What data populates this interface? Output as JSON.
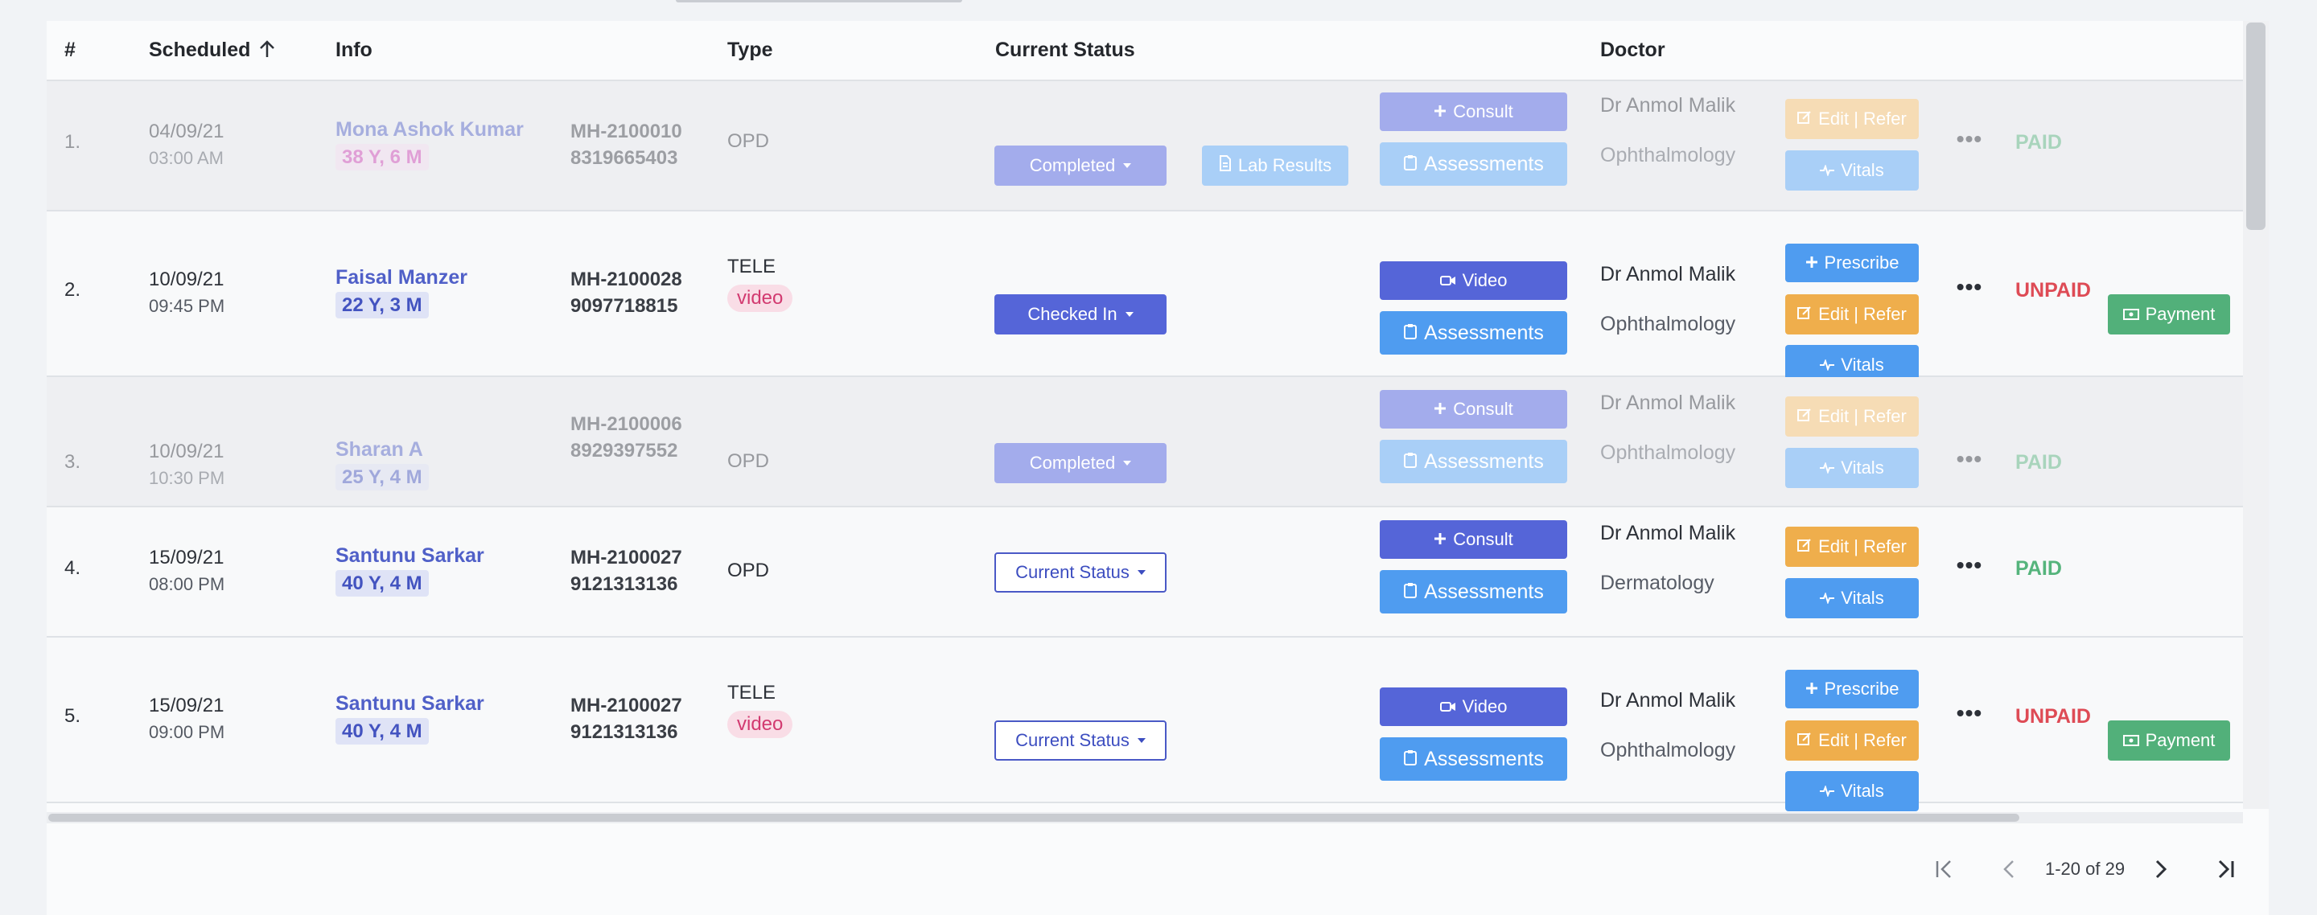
{
  "table": {
    "headers": {
      "num": "#",
      "scheduled": "Scheduled",
      "info": "Info",
      "type": "Type",
      "current_status": "Current Status",
      "doctor": "Doctor"
    },
    "rows": [
      {
        "num": "1.",
        "date": "04/09/21",
        "time": "03:00 AM",
        "name": "Mona Ashok Kumar",
        "age": "38 Y, 6 M",
        "mrn": "MH-2100010",
        "phone": "8319665403",
        "type": "OPD",
        "type_tag": "",
        "status": "Completed",
        "lab": "Lab Results",
        "action": "Consult",
        "assess": "Assessments",
        "doctor": "Dr Anmol Malik",
        "specialty": "Ophthalmology",
        "prescribe": "",
        "edit": "Edit | Refer",
        "vitals": "Vitals",
        "payment_status": "PAID",
        "payment_button": ""
      },
      {
        "num": "2.",
        "date": "10/09/21",
        "time": "09:45 PM",
        "name": "Faisal Manzer",
        "age": "22 Y, 3 M",
        "mrn": "MH-2100028",
        "phone": "9097718815",
        "type": "TELE",
        "type_tag": "video",
        "status": "Checked In",
        "lab": "",
        "action": "Video",
        "assess": "Assessments",
        "doctor": "Dr Anmol Malik",
        "specialty": "Ophthalmology",
        "prescribe": "Prescribe",
        "edit": "Edit | Refer",
        "vitals": "Vitals",
        "payment_status": "UNPAID",
        "payment_button": "Payment"
      },
      {
        "num": "3.",
        "date": "10/09/21",
        "time": "10:30 PM",
        "name": "Sharan A",
        "age": "25 Y, 4 M",
        "mrn": "MH-2100006",
        "phone": "8929397552",
        "type": "OPD",
        "type_tag": "",
        "status": "Completed",
        "lab": "",
        "action": "Consult",
        "assess": "Assessments",
        "doctor": "Dr Anmol Malik",
        "specialty": "Ophthalmology",
        "prescribe": "",
        "edit": "Edit | Refer",
        "vitals": "Vitals",
        "payment_status": "PAID",
        "payment_button": ""
      },
      {
        "num": "4.",
        "date": "15/09/21",
        "time": "08:00 PM",
        "name": "Santunu Sarkar",
        "age": "40 Y, 4 M",
        "mrn": "MH-2100027",
        "phone": "9121313136",
        "type": "OPD",
        "type_tag": "",
        "status": "Current Status",
        "lab": "",
        "action": "Consult",
        "assess": "Assessments",
        "doctor": "Dr Anmol Malik",
        "specialty": "Dermatology",
        "prescribe": "",
        "edit": "Edit | Refer",
        "vitals": "Vitals",
        "payment_status": "PAID",
        "payment_button": ""
      },
      {
        "num": "5.",
        "date": "15/09/21",
        "time": "09:00 PM",
        "name": "Santunu Sarkar",
        "age": "40 Y, 4 M",
        "mrn": "MH-2100027",
        "phone": "9121313136",
        "type": "TELE",
        "type_tag": "video",
        "status": "Current Status",
        "lab": "",
        "action": "Video",
        "assess": "Assessments",
        "doctor": "Dr Anmol Malik",
        "specialty": "Ophthalmology",
        "prescribe": "Prescribe",
        "edit": "Edit | Refer",
        "vitals": "Vitals",
        "payment_status": "UNPAID",
        "payment_button": "Payment"
      }
    ]
  },
  "pagination": {
    "range": "1-20 of 29"
  },
  "colors": {
    "indigo": "#5565d8",
    "blue": "#4f9cf0",
    "orange": "#efae4c",
    "green": "#52b07a",
    "paid": "#55b47c",
    "unpaid": "#de4b55"
  }
}
